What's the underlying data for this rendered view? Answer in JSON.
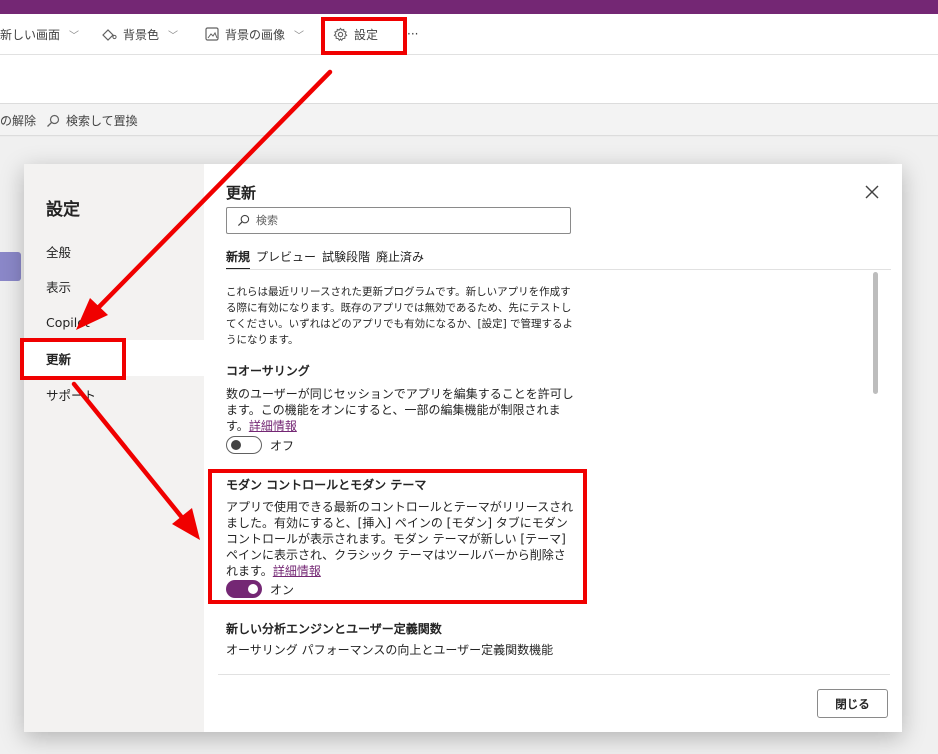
{
  "commandbar": {
    "new_screen": "新しい画面",
    "background_color": "背景色",
    "background_image": "背景の画像",
    "settings": "設定",
    "more": "···"
  },
  "toolbar3": {
    "unlock": "の解除",
    "find_replace": "検索して置換"
  },
  "dialog": {
    "nav_title": "設定",
    "nav_items": [
      {
        "label": "全般"
      },
      {
        "label": "表示"
      },
      {
        "label": "Copilot"
      },
      {
        "label": "更新"
      },
      {
        "label": "サポート"
      }
    ],
    "active_nav": "更新",
    "content_title": "更新",
    "search": {
      "placeholder": "検索",
      "value": ""
    },
    "tabs": [
      {
        "label": "新規"
      },
      {
        "label": "プレビュー"
      },
      {
        "label": "試験段階"
      },
      {
        "label": "廃止済み"
      }
    ],
    "active_tab": "新規",
    "intro": "これらは最近リリースされた更新プログラムです。新しいアプリを作成する際に有効になります。既存のアプリでは無効であるため、先にテストしてください。いずれはどのアプリでも有効になるか、[設定] で管理するようになります。",
    "sections": [
      {
        "title": "コオーサリング",
        "description": "数のユーザーが同じセッションでアプリを編集することを許可します。この機能をオンにすると、一部の編集機能が制限されます。",
        "link": "詳細情報",
        "toggle_label": "オフ",
        "toggle_on": false
      },
      {
        "title": "モダン コントロールとモダン テーマ",
        "description": "アプリで使用できる最新のコントロールとテーマがリリースされました。有効にすると、[挿入] ペインの [モダン] タブにモダン コントロールが表示されます。モダン テーマが新しい [テーマ] ペインに表示され、クラシック テーマはツールバーから削除されます。",
        "link": "詳細情報",
        "toggle_label": "オン",
        "toggle_on": true
      },
      {
        "title": "新しい分析エンジンとユーザー定義関数",
        "description": "オーサリング パフォーマンスの向上とユーザー定義関数機能",
        "link": "",
        "toggle_label": "",
        "toggle_on": false
      }
    ],
    "close_button": "閉じる"
  },
  "colors": {
    "brand_purple": "#742774",
    "annotation_red": "#f00000"
  },
  "icons": [
    "background-color-icon",
    "background-image-icon",
    "gear-icon",
    "search-icon",
    "close-icon",
    "chevron-down-icon"
  ]
}
